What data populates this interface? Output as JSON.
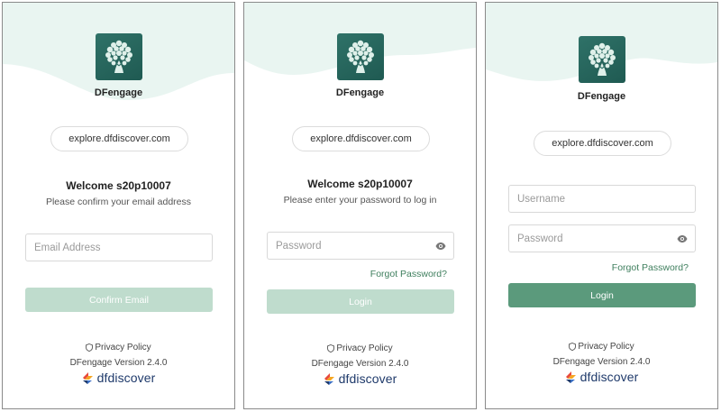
{
  "common": {
    "app_name": "DFengage",
    "server": "explore.dfdiscover.com",
    "privacy_label": "Privacy Policy",
    "version": "DFengage Version 2.4.0",
    "brand_name": "dfdiscover",
    "colors": {
      "accent_green": "#5b9a7c",
      "disabled_green": "#bfdccd",
      "link_green": "#3f7f5e",
      "wave_mint": "#e9f5f1",
      "logo_teal": "#2f7268",
      "brand_navy": "#1f3a6b"
    },
    "icons": {
      "logo": "tree-icon",
      "privacy": "shield-icon",
      "password_toggle": "eye-icon",
      "brand": "dfdiscover-mark-icon"
    }
  },
  "email_screen": {
    "welcome": "Welcome s20p10007",
    "subtext": "Please confirm your email address",
    "email_placeholder": "Email Address",
    "confirm_button": "Confirm Email"
  },
  "password_screen": {
    "welcome": "Welcome s20p10007",
    "subtext": "Please enter your password to log in",
    "password_placeholder": "Password",
    "forgot_link": "Forgot Password?",
    "login_button": "Login"
  },
  "login_screen": {
    "username_placeholder": "Username",
    "password_placeholder": "Password",
    "forgot_link": "Forgot Password?",
    "login_button": "Login"
  }
}
